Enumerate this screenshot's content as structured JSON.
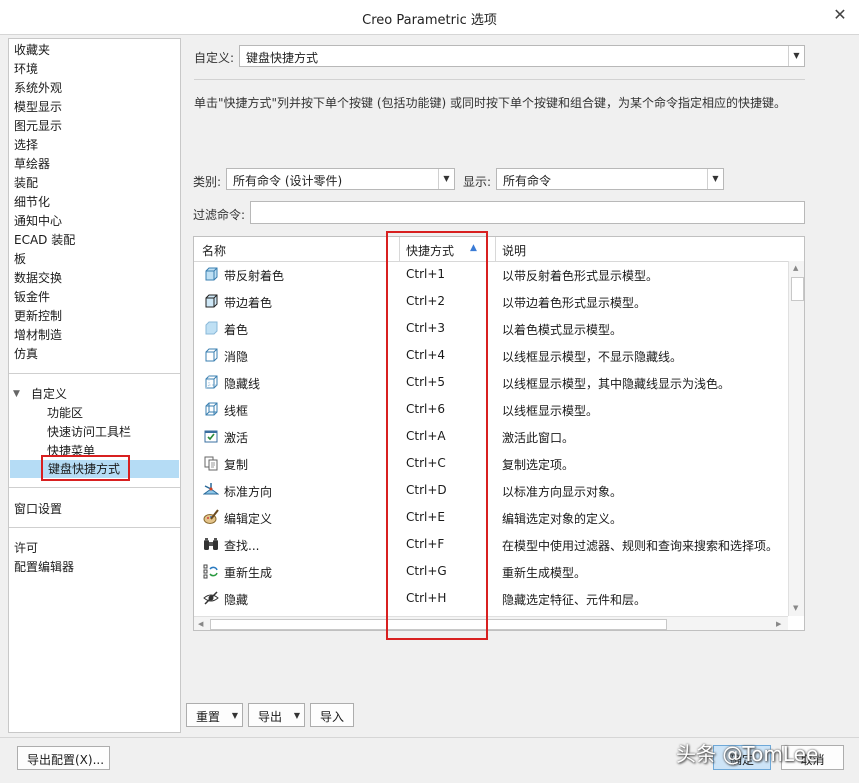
{
  "window": {
    "title": "Creo Parametric 选项"
  },
  "sidebar": {
    "items": [
      "收藏夹",
      "环境",
      "系统外观",
      "模型显示",
      "图元显示",
      "选择",
      "草绘器",
      "装配",
      "细节化",
      "通知中心",
      "ECAD 装配",
      "板",
      "数据交换",
      "钣金件",
      "更新控制",
      "增材制造",
      "仿真"
    ],
    "customize": "自定义",
    "sub_items": [
      "功能区",
      "快速访问工具栏",
      "快捷菜单",
      "键盘快捷方式"
    ],
    "window_settings": "窗口设置",
    "license": "许可",
    "config_editor": "配置编辑器"
  },
  "customize_row": {
    "label": "自定义:",
    "value": "键盘快捷方式"
  },
  "instructions": "单击\"快捷方式\"列并按下单个按键 (包括功能键) 或同时按下单个按键和组合键，为某个命令指定相应的快捷键。",
  "category": {
    "label": "类别:",
    "value": "所有命令 (设计零件)"
  },
  "display": {
    "label": "显示:",
    "value": "所有命令"
  },
  "filter": {
    "label": "过滤命令:",
    "value": ""
  },
  "table": {
    "headers": {
      "name": "名称",
      "shortcut": "快捷方式",
      "description": "说明"
    },
    "rows": [
      {
        "icon": "shaded-reflections-icon",
        "name": "带反射着色",
        "key": "Ctrl+1",
        "desc": "以带反射着色形式显示模型。"
      },
      {
        "icon": "shaded-edges-icon",
        "name": "带边着色",
        "key": "Ctrl+2",
        "desc": "以带边着色形式显示模型。"
      },
      {
        "icon": "shading-icon",
        "name": "着色",
        "key": "Ctrl+3",
        "desc": "以着色模式显示模型。"
      },
      {
        "icon": "no-hidden-icon",
        "name": "消隐",
        "key": "Ctrl+4",
        "desc": "以线框显示模型，不显示隐藏线。"
      },
      {
        "icon": "hidden-line-icon",
        "name": "隐藏线",
        "key": "Ctrl+5",
        "desc": "以线框显示模型，其中隐藏线显示为浅色。"
      },
      {
        "icon": "wireframe-icon",
        "name": "线框",
        "key": "Ctrl+6",
        "desc": "以线框显示模型。"
      },
      {
        "icon": "activate-icon",
        "name": "激活",
        "key": "Ctrl+A",
        "desc": "激活此窗口。"
      },
      {
        "icon": "copy-icon",
        "name": "复制",
        "key": "Ctrl+C",
        "desc": "复制选定项。"
      },
      {
        "icon": "standard-orientation-icon",
        "name": "标准方向",
        "key": "Ctrl+D",
        "desc": "以标准方向显示对象。"
      },
      {
        "icon": "edit-definition-icon",
        "name": "编辑定义",
        "key": "Ctrl+E",
        "desc": "编辑选定对象的定义。"
      },
      {
        "icon": "binoculars-icon",
        "name": "查找...",
        "key": "Ctrl+F",
        "desc": "在模型中使用过滤器、规则和查询来搜索和选择项。"
      },
      {
        "icon": "regenerate-icon",
        "name": "重新生成",
        "key": "Ctrl+G",
        "desc": "重新生成模型。"
      },
      {
        "icon": "hide-eye-icon",
        "name": "隐藏",
        "key": "Ctrl+H",
        "desc": "隐藏选定特征、元件和层。"
      }
    ]
  },
  "buttons": {
    "reset": "重置",
    "export": "导出",
    "import": "导入",
    "export_config": "导出配置(X)...",
    "ok": "确定",
    "cancel": "取消"
  },
  "watermark": "头条 @TomLee",
  "colors": {
    "selection": "#b5dcf5",
    "highlight": "#d82020"
  }
}
